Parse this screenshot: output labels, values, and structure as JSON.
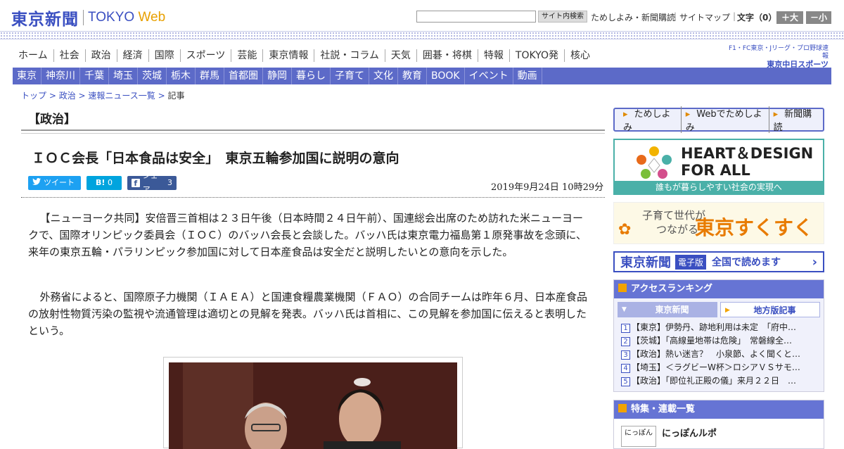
{
  "header": {
    "logo_jp": "東京新聞",
    "logo_en_1": "TOKYO",
    "logo_en_2": "Web",
    "search_btn": "サイト内検索",
    "links": [
      "ためしよみ・新聞購読",
      "サイトマップ"
    ],
    "font_size_label": "文字（0）",
    "font_up": "＋大",
    "font_down": "－小"
  },
  "nav_main": [
    "ホーム",
    "社会",
    "政治",
    "経済",
    "国際",
    "スポーツ",
    "芸能",
    "東京情報",
    "社説・コラム",
    "天気",
    "囲碁・将棋",
    "特報",
    "TOKYO発",
    "核心"
  ],
  "chunichi": {
    "line1": "F1・FC東京・Jリーグ・プロ野球速報",
    "line2": "東京中日スポーツ"
  },
  "nav_local": [
    "東京",
    "神奈川",
    "千葉",
    "埼玉",
    "茨城",
    "栃木",
    "群馬",
    "首都圏",
    "静岡",
    "暮らし",
    "子育て",
    "文化",
    "教育",
    "BOOK",
    "イベント",
    "動画"
  ],
  "breadcrumb": {
    "items": [
      "トップ",
      "政治",
      "速報ニュース一覧"
    ],
    "current": "記事"
  },
  "section": "【政治】",
  "article": {
    "headline": "ＩＯＣ会長「日本食品は安全」　東京五輪参加国に説明の意向",
    "tweet": "ツイート",
    "hatena": "B!",
    "hatena_count": "0",
    "share": "シェア",
    "share_count": "3",
    "date": "2019年9月24日 10時29分",
    "paragraphs": [
      "【ニューヨーク共同】安倍晋三首相は２３日午後（日本時間２４日午前）、国連総会出席のため訪れた米ニューヨークで、国際オリンピック委員会（ＩＯＣ）のバッハ会長と会談した。バッハ氏は東京電力福島第１原発事故を念頭に、来年の東京五輪・パラリンピック参加国に対して日本産食品は安全だと説明したいとの意向を示した。",
      "外務省によると、国際原子力機関（ＩＡＥＡ）と国連食糧農業機関（ＦＡＯ）の合同チームは昨年６月、日本産食品の放射性物質汚染の監視や流通管理は適切との見解を発表。バッハ氏は首相に、この見解を参加国に伝えると表明したという。"
    ]
  },
  "aside": {
    "yomi": [
      "ためしよみ",
      "Webでためしよみ",
      "新聞購読"
    ],
    "heart_title_1": "HEART＆DESIGN",
    "heart_title_2": "FOR ALL",
    "heart_sub": "誰もが暮らしやすい社会の実現へ",
    "suku_line1": "子育て世代が",
    "suku_line2": "つながる",
    "suku_brand": "東京すくすく",
    "denshi_logo": "東京新聞",
    "denshi_badge": "電子版",
    "denshi_text": "全国で読めます",
    "ranking_title": "アクセスランキング",
    "ranking_tabs": [
      "東京新聞",
      "地方版記事"
    ],
    "ranking": [
      "【東京】伊勢丹、跡地利用は未定　「府中…",
      "【茨城】「高線量地帯は危険」　常磐線全…",
      "【政治】熱い迷言？　小泉節、よく聞くと…",
      "【埼玉】＜ラグビーW杯＞ロシアＶＳサモ…",
      "【政治】「即位礼正殿の儀」来月２２日　…"
    ],
    "feature_title": "特集・連載一覧",
    "feature_item": "にっぽんルポ",
    "feature_thumb": "にっぽん"
  }
}
